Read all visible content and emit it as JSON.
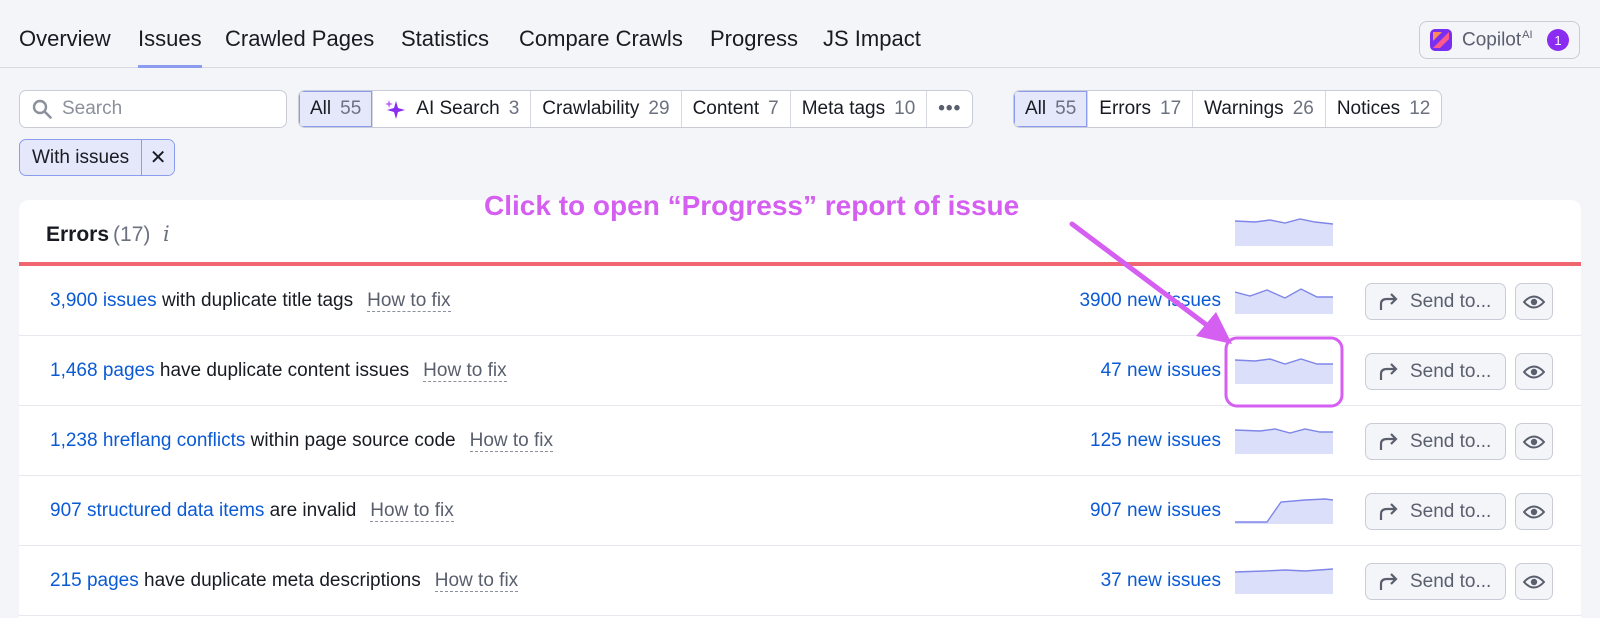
{
  "nav": {
    "tabs": [
      {
        "label": "Overview"
      },
      {
        "label": "Issues",
        "active": true
      },
      {
        "label": "Crawled Pages"
      },
      {
        "label": "Statistics"
      },
      {
        "label": "Compare Crawls"
      },
      {
        "label": "Progress"
      },
      {
        "label": "JS Impact"
      }
    ],
    "copilot": {
      "label": "Copilot",
      "sup": "AI",
      "badge": "1"
    }
  },
  "filters": {
    "search_placeholder": "Search",
    "categories": [
      {
        "label": "All",
        "count": "55",
        "selected": true
      },
      {
        "label": "AI Search",
        "count": "3",
        "icon": "sparkle-icon"
      },
      {
        "label": "Crawlability",
        "count": "29"
      },
      {
        "label": "Content",
        "count": "7"
      },
      {
        "label": "Meta tags",
        "count": "10"
      }
    ],
    "more_label": "•••",
    "severity": [
      {
        "label": "All",
        "count": "55",
        "selected": true
      },
      {
        "label": "Errors",
        "count": "17"
      },
      {
        "label": "Warnings",
        "count": "26"
      },
      {
        "label": "Notices",
        "count": "12"
      }
    ],
    "chip_label": "With issues",
    "chip_close": "✕"
  },
  "errors": {
    "title": "Errors",
    "count": "(17)",
    "info": "i",
    "send_label": "Send to...",
    "rows": [
      {
        "link": "3,900 issues",
        "text": " with duplicate title tags",
        "fix": "How to fix",
        "new_issues": "3900 new issues"
      },
      {
        "link": "1,468 pages",
        "text": " have duplicate content issues",
        "fix": "How to fix",
        "new_issues": "47 new issues"
      },
      {
        "link": "1,238 hreflang conflicts",
        "text": " within page source code",
        "fix": "How to fix",
        "new_issues": "125 new issues"
      },
      {
        "link": "907 structured data items",
        "text": " are invalid",
        "fix": "How to fix",
        "new_issues": "907 new issues"
      },
      {
        "link": "215 pages",
        "text": " have duplicate meta descriptions",
        "fix": "How to fix",
        "new_issues": "37 new issues"
      }
    ]
  },
  "annotation": {
    "text": "Click to open “Progress” report of issue",
    "color": "#d45ff0"
  },
  "colors": {
    "link": "#0a5ad6",
    "error_bar": "#f0666e",
    "accent": "#8b9cf0",
    "spark_fill": "#dcdffa",
    "spark_line": "#7f86e8"
  }
}
